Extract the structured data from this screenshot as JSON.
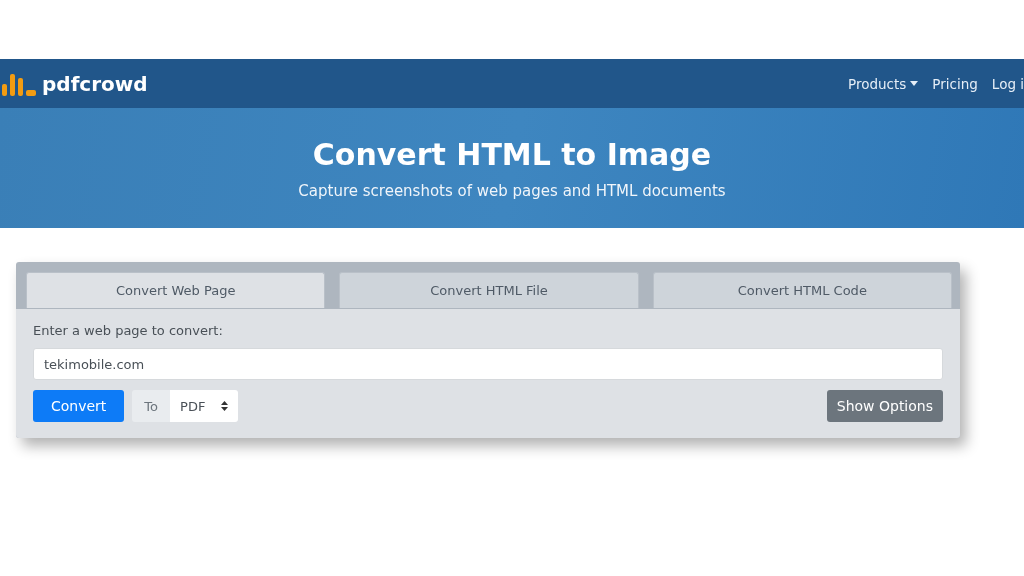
{
  "navbar": {
    "brand": "pdfcrowd",
    "links": [
      {
        "label": "Products",
        "dropdown": true
      },
      {
        "label": "Pricing",
        "dropdown": false
      },
      {
        "label": "Log i",
        "dropdown": false
      }
    ]
  },
  "hero": {
    "title": "Convert HTML to Image",
    "subtitle": "Capture screenshots of web pages and HTML documents"
  },
  "tabs": [
    {
      "label": "Convert Web Page",
      "selected": true
    },
    {
      "label": "Convert HTML File",
      "selected": false
    },
    {
      "label": "Convert HTML Code",
      "selected": false
    }
  ],
  "form": {
    "label": "Enter a web page to convert:",
    "value": "tekimobile.com",
    "convert_button": "Convert",
    "to_label": "To",
    "format": "PDF",
    "options_button": "Show Options"
  }
}
